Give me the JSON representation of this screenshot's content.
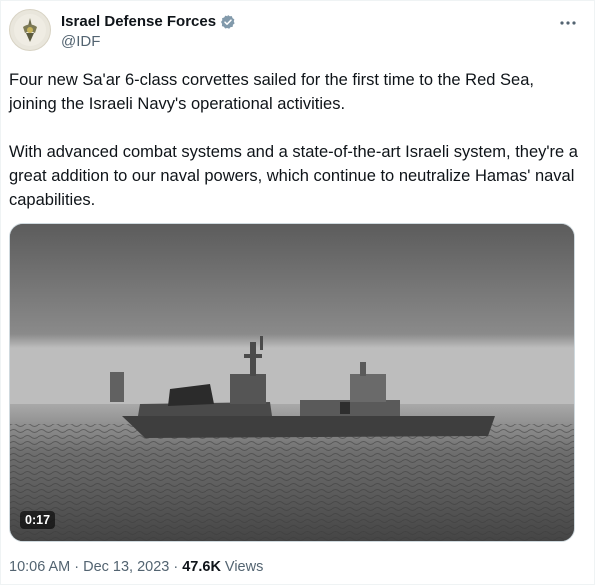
{
  "author": {
    "name": "Israel Defense Forces",
    "handle": "@IDF",
    "verified_color": "#829aab"
  },
  "tweet": {
    "text": "Four new Sa'ar 6-class corvettes sailed for the first time to the Red Sea, joining the Israeli Navy's operational activities.\n\nWith advanced combat systems and a state-of-the-art Israeli system, they're a great addition to our naval powers, which continue to neutralize Hamas' naval capabilities."
  },
  "video": {
    "duration": "0:17"
  },
  "meta": {
    "time": "10:06 AM",
    "separator": "·",
    "date": "Dec 13, 2023",
    "views_count": "47.6K",
    "views_label": "Views"
  },
  "icons": {
    "more": "more-horizontal-icon",
    "verified": "verified-badge-icon"
  }
}
